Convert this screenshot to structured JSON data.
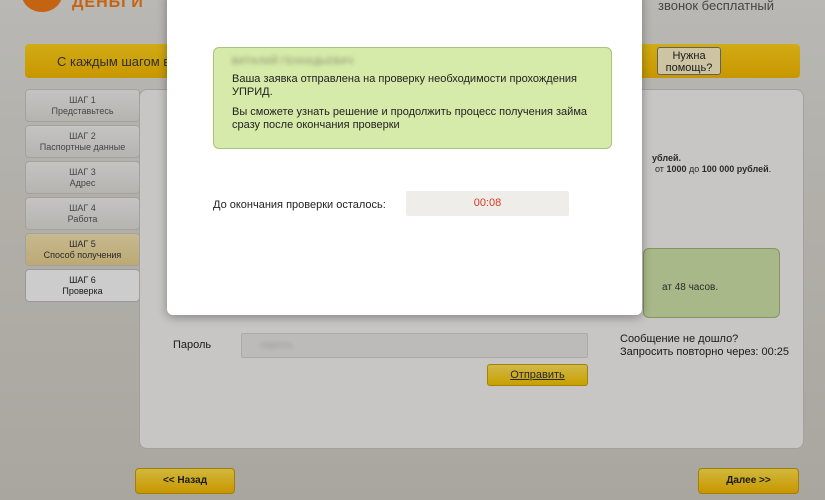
{
  "header": {
    "logo_text": "ДЕНЬГИ",
    "phone_text": "звонок бесплатный"
  },
  "banner": {
    "text": "С каждым шагом ве",
    "help_label": "Нужна помощь?"
  },
  "steps": [
    {
      "num": "ШАГ 1",
      "label": "Представьтесь"
    },
    {
      "num": "ШАГ 2",
      "label": "Паспортные данные"
    },
    {
      "num": "ШАГ 3",
      "label": "Адрес"
    },
    {
      "num": "ШАГ 4",
      "label": "Работа"
    },
    {
      "num": "ШАГ 5",
      "label": "Способ получения"
    },
    {
      "num": "ШАГ 6",
      "label": "Проверка"
    }
  ],
  "main": {
    "right_text1": "ублей.",
    "right_text2_pre": "от ",
    "right_text2_min": "1000",
    "right_text2_mid": " до ",
    "right_text2_max": "100 000 рублей",
    "right_text2_post": ".",
    "green_text": "ат 48 часов.",
    "password_label": "Пароль",
    "password_value": "пароль",
    "resend_line1": "Сообщение не дошло?",
    "resend_line2": "Запросить повторно через: 00:25",
    "send_label": "Отправить"
  },
  "nav": {
    "back_label": "<< Назад",
    "next_label": "Далее >>"
  },
  "modal": {
    "name_blurred": "ВИТАЛИЙ ГЕННАДЬЕВИЧ",
    "line1": "Ваша заявка отправлена на проверку необходимости прохождения УПРИД.",
    "line2": "Вы сможете узнать решение и продолжить процесс получения займа сразу после окончания проверки",
    "timer_label": "До окончания проверки осталось:",
    "timer_value": "00:08"
  },
  "colors": {
    "accent_yellow": "#f5c400",
    "logo_orange": "#f07a18",
    "notice_green": "#d6eaa9",
    "timer_red": "#d83a1e"
  }
}
